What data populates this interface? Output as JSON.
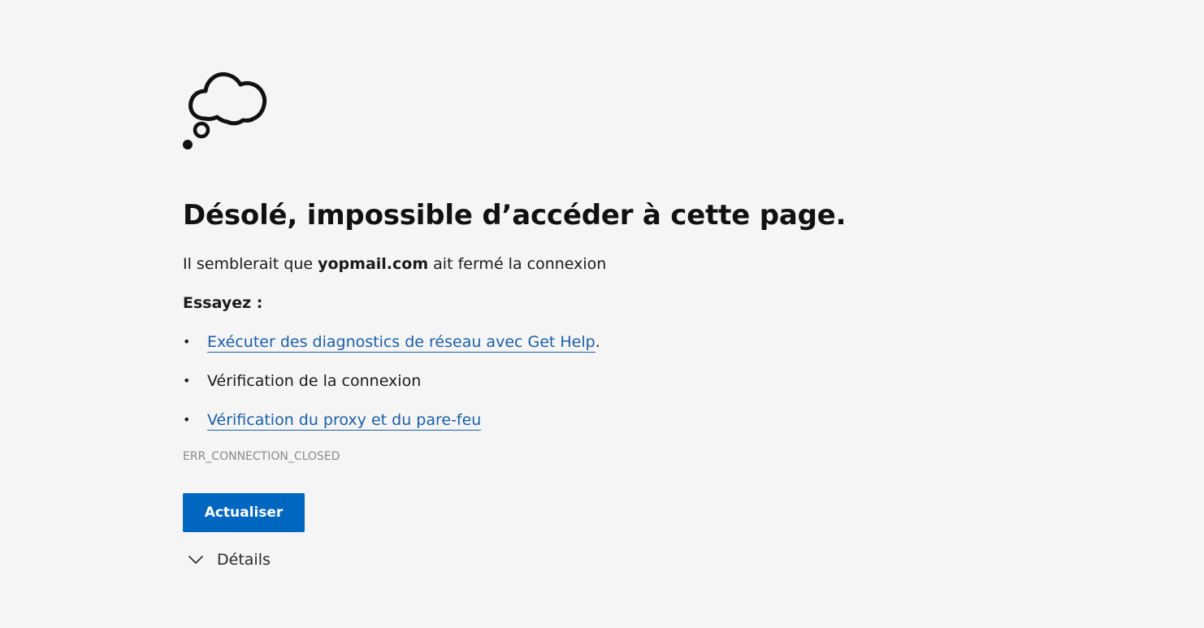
{
  "error_page": {
    "title": "Désolé, impossible d’accéder à cette page.",
    "message_prefix": "Il semblerait que ",
    "domain": "yopmail.com",
    "message_suffix": " ait fermé la connexion",
    "try_heading": "Essayez :",
    "suggestions": [
      {
        "text": "Exécuter des diagnostics de réseau avec Get Help",
        "trailing": ".",
        "is_link": true
      },
      {
        "text": "Vérification de la connexion",
        "trailing": "",
        "is_link": false
      },
      {
        "text": "Vérification du proxy et du pare-feu",
        "trailing": "",
        "is_link": true
      }
    ],
    "bullet": "•",
    "error_code": "ERR_CONNECTION_CLOSED",
    "refresh_label": "Actualiser",
    "details_label": "Détails"
  },
  "icons": {
    "illustration": "thought-cloud-icon",
    "details": "chevron-down-icon"
  },
  "colors": {
    "background": "#f5f5f5",
    "link": "#1a5fa8",
    "button": "#0067c0",
    "error_code": "#8a8a8a"
  }
}
